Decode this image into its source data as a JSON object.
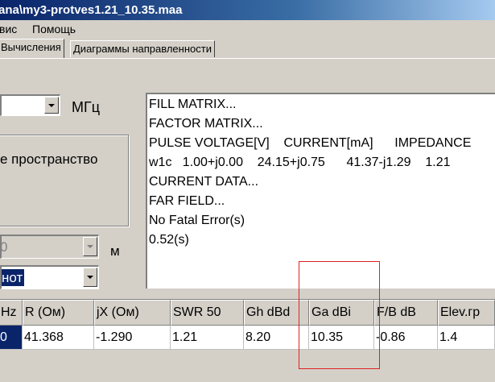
{
  "window": {
    "title": "ana\\my3-protves1.21_10.35.maa"
  },
  "menu": {
    "items": [
      "вис",
      "Помощь"
    ]
  },
  "tabs": [
    {
      "label": "Вычисления",
      "active": true
    },
    {
      "label": "Диаграммы направленности",
      "active": false
    }
  ],
  "frequency": {
    "value": "",
    "unit": "МГц"
  },
  "environment": {
    "label": "е пространство"
  },
  "height": {
    "value": "0",
    "unit": "м"
  },
  "ground": {
    "value": "нот"
  },
  "output": {
    "lines": [
      "FILL MATRIX...",
      "FACTOR MATRIX...",
      "PULSE VOLTAGE[V]    CURRENT[mA]      IMPEDANCE",
      "w1c   1.00+j0.00    24.15+j0.75      41.37-j1.29    1.21",
      "CURRENT DATA...",
      "FAR FIELD...",
      "No Fatal Error(s)",
      "0.52(s)"
    ]
  },
  "results": {
    "headers": [
      "Hz",
      "R (Ом)",
      "jX (Ом)",
      "SWR 50",
      "Gh dBd",
      "Ga dBi",
      "F/B dB",
      "Elev.гр"
    ],
    "row": [
      "0",
      "41.368",
      "-1.290",
      "1.21",
      "8.20",
      "10.35",
      "-0.86",
      "1.4"
    ]
  },
  "colors": {
    "title_active": "#0a246a",
    "selection": "#0a246a",
    "face": "#d4d0c8",
    "annotation": "#dd2222"
  }
}
